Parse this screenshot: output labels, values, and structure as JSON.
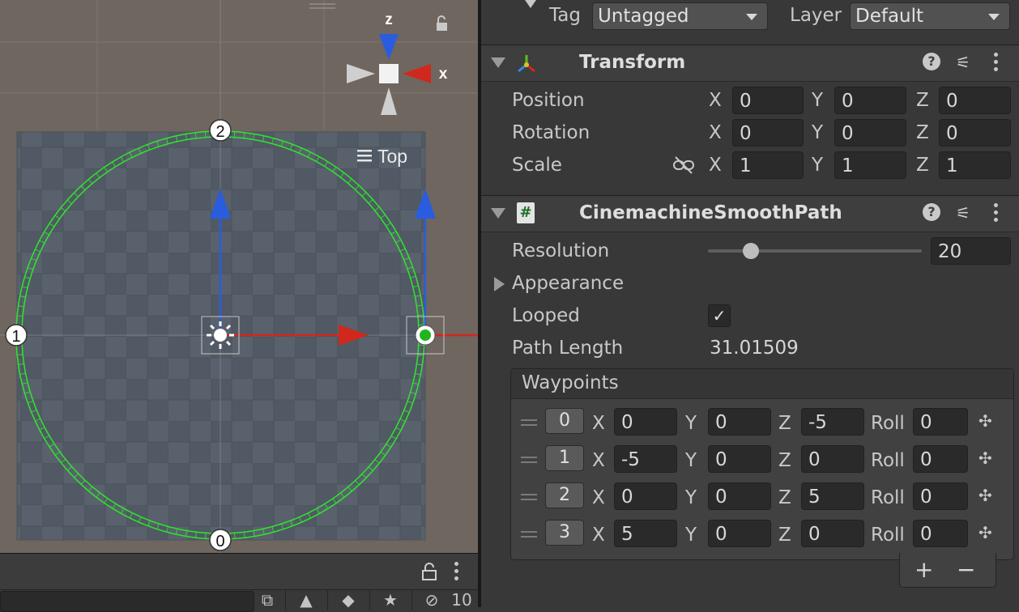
{
  "scene": {
    "view_label": "Top",
    "gizmo": {
      "z_label": "z",
      "x_label": "x"
    },
    "waypoint_labels": [
      "0",
      "1",
      "2"
    ],
    "lock_icon": "lock-icon"
  },
  "project_bar": {
    "lock_icon": "lock-icon",
    "menu_icon": "kebab-icon",
    "hidden_count": "10",
    "icons": [
      "open-external-icon",
      "shapes-icon",
      "tag-icon",
      "star-icon",
      "eye-hidden-icon"
    ]
  },
  "inspector": {
    "tag_label": "Tag",
    "tag_value": "Untagged",
    "layer_label": "Layer",
    "layer_value": "Default",
    "transform": {
      "title": "Transform",
      "rows": [
        {
          "label": "Position",
          "x": "0",
          "y": "0",
          "z": "0"
        },
        {
          "label": "Rotation",
          "x": "0",
          "y": "0",
          "z": "0"
        },
        {
          "label": "Scale",
          "x": "1",
          "y": "1",
          "z": "1"
        }
      ],
      "axis": {
        "x": "X",
        "y": "Y",
        "z": "Z"
      }
    },
    "path": {
      "title": "CinemachineSmoothPath",
      "script_icon": "#",
      "resolution_label": "Resolution",
      "resolution_value": "20",
      "resolution_fraction": 0.2,
      "appearance_label": "Appearance",
      "looped_label": "Looped",
      "looped_checked": true,
      "path_length_label": "Path Length",
      "path_length_value": "31.01509",
      "waypoints_label": "Waypoints",
      "roll_label": "Roll",
      "waypoints": [
        {
          "index": "0",
          "x": "0",
          "y": "0",
          "z": "-5",
          "roll": "0"
        },
        {
          "index": "1",
          "x": "-5",
          "y": "0",
          "z": "0",
          "roll": "0"
        },
        {
          "index": "2",
          "x": "0",
          "y": "0",
          "z": "5",
          "roll": "0"
        },
        {
          "index": "3",
          "x": "5",
          "y": "0",
          "z": "0",
          "roll": "0"
        }
      ],
      "add_label": "+",
      "remove_label": "−"
    },
    "colors": {
      "x_axis": "#d0281c",
      "y_axis": "#5fbd1a",
      "z_axis": "#2a5ce0",
      "path": "#2ee62e"
    }
  }
}
